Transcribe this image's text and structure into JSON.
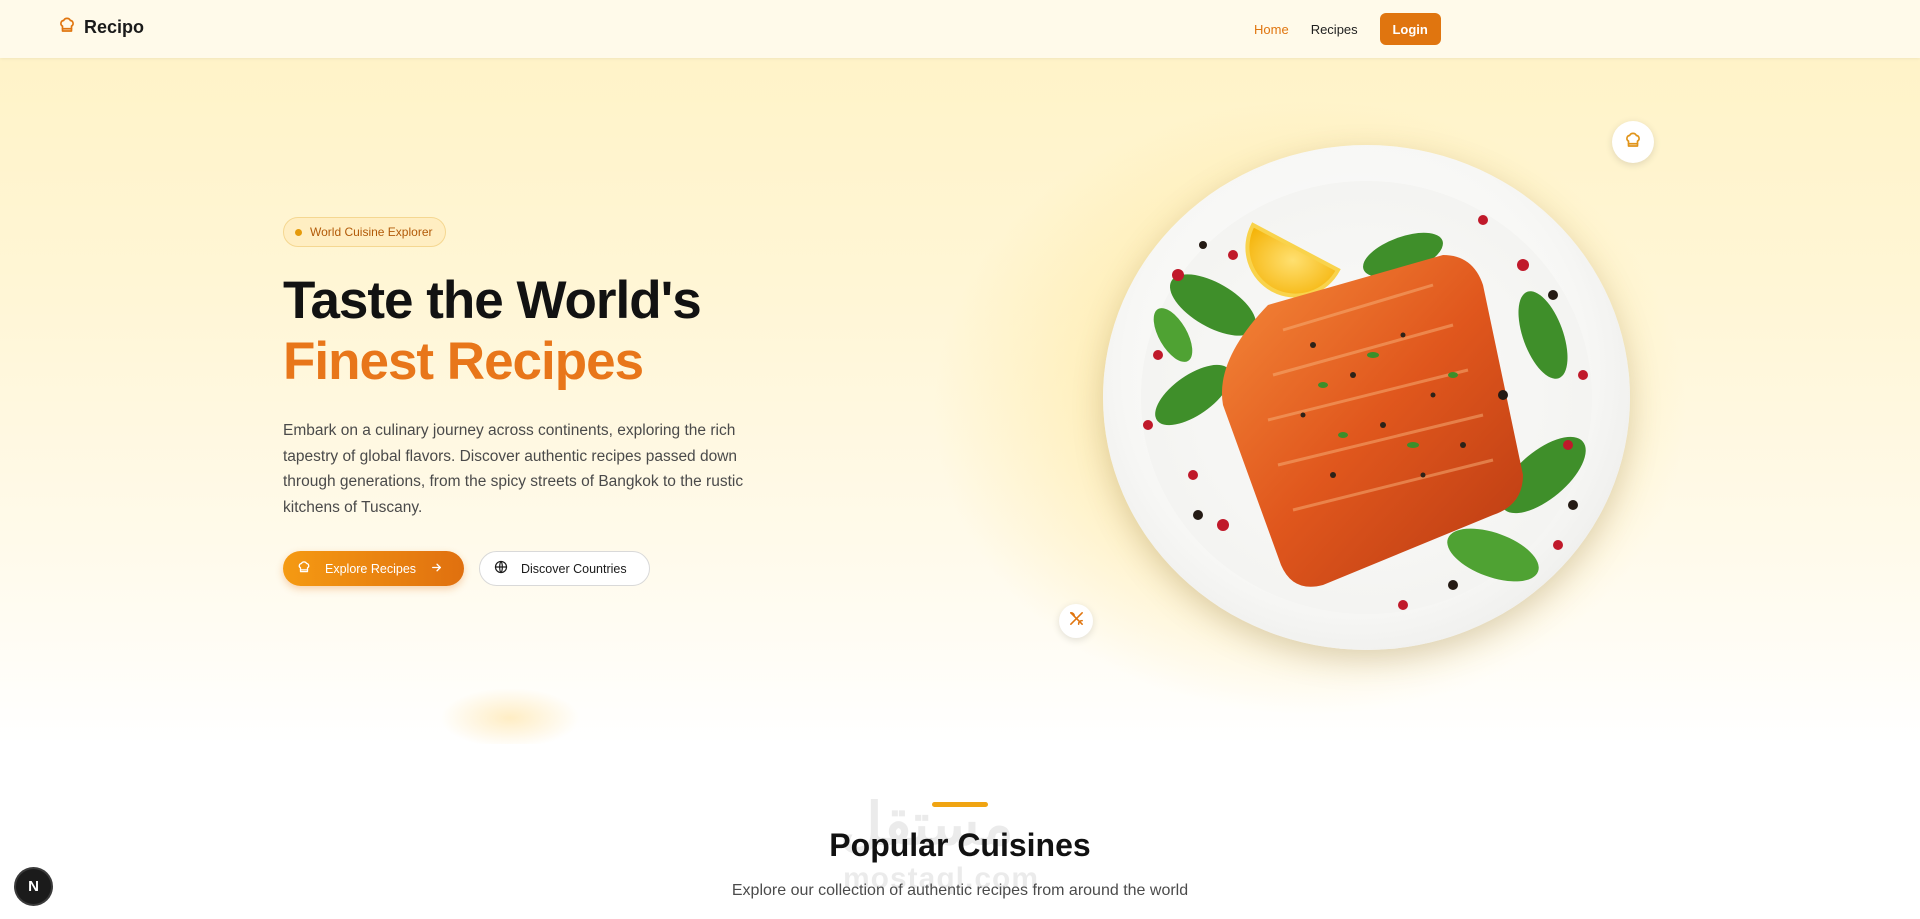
{
  "nav": {
    "brand": "Recipo",
    "brand_icon": "chef-hat-icon",
    "links": [
      {
        "label": "Home",
        "active": true
      },
      {
        "label": "Recipes",
        "active": false
      }
    ],
    "login_label": "Login",
    "accent_color": "#e0750f"
  },
  "hero": {
    "badge": "World Cuisine Explorer",
    "title_line1": "Taste the World's",
    "title_line2": "Finest Recipes",
    "description": "Embark on a culinary journey across continents, exploring the rich tapestry of global flavors. Discover authentic recipes passed down through generations, from the spicy streets of Bangkok to the rustic kitchens of Tuscany.",
    "primary_button": "Explore Recipes",
    "secondary_button": "Discover Countries",
    "image_subject": "grilled salmon fillet on a white plate with basil, lemon and peppercorns"
  },
  "section": {
    "title": "Popular Cuisines",
    "subtitle": "Explore our collection of authentic recipes from around the world"
  },
  "watermark": {
    "arabic": "مستقل",
    "latin": "mostaql.com"
  },
  "dev_badge": "N"
}
